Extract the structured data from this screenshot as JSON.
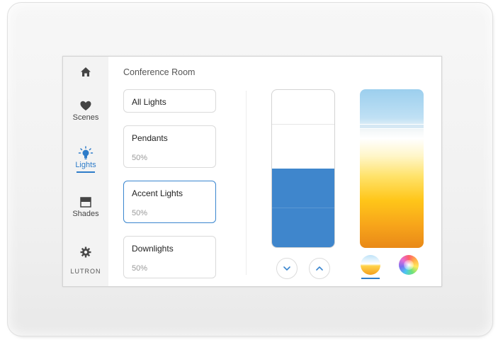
{
  "nav": {
    "items": [
      {
        "id": "home",
        "label": "",
        "icon": "home-icon"
      },
      {
        "id": "scenes",
        "label": "Scenes",
        "icon": "heart-icon"
      },
      {
        "id": "lights",
        "label": "Lights",
        "icon": "lightbulb-icon",
        "active": true
      },
      {
        "id": "shades",
        "label": "Shades",
        "icon": "shade-icon"
      },
      {
        "id": "settings",
        "label": "",
        "icon": "gear-icon"
      }
    ],
    "brand": "LUTRON"
  },
  "room": {
    "title": "Conference Room"
  },
  "zones": [
    {
      "name": "All Lights",
      "level": ""
    },
    {
      "name": "Pendants",
      "level": "50%"
    },
    {
      "name": "Accent Lights",
      "level": "50%",
      "selected": true
    },
    {
      "name": "Downlights",
      "level": "50%"
    }
  ],
  "dimmer": {
    "level": 0.5,
    "fill_color": "#3f86cc",
    "down_icon": "chevron-down-icon",
    "up_icon": "chevron-up-icon"
  },
  "color_temp": {
    "handle_level": 0.78,
    "mode_icons": [
      "warm-dim-icon",
      "color-wheel-icon"
    ],
    "active_mode": "warm-dim-icon"
  },
  "colors": {
    "accent": "#2e7cc9"
  }
}
